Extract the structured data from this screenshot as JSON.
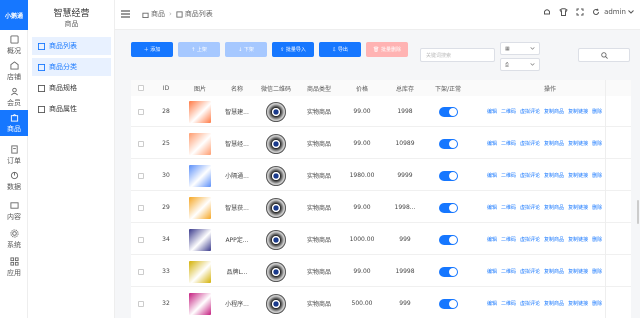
{
  "app": {
    "logo_text": "小鹅通",
    "brand_color": "#1677ff"
  },
  "rail": {
    "items": [
      {
        "label": "概况",
        "icon": "dashboard-icon"
      },
      {
        "label": "店铺",
        "icon": "store-icon"
      },
      {
        "label": "会员",
        "icon": "user-icon"
      },
      {
        "label": "商品",
        "icon": "goods-icon",
        "active": true
      },
      {
        "label": "订单",
        "icon": "order-icon"
      },
      {
        "label": "数据",
        "icon": "data-icon"
      },
      {
        "label": "内容",
        "icon": "content-icon"
      },
      {
        "label": "系统",
        "icon": "gear-icon"
      },
      {
        "label": "应用",
        "icon": "apps-icon"
      }
    ]
  },
  "submenu": {
    "title": "智慧经营",
    "subtitle": "商品",
    "items": [
      {
        "label": "商品列表",
        "active": true
      },
      {
        "label": "商品分类",
        "active": true
      },
      {
        "label": "商品规格",
        "active": false
      },
      {
        "label": "商品属性",
        "active": false
      }
    ]
  },
  "header": {
    "breadcrumb": [
      "商品",
      "商品列表"
    ],
    "user": "admin"
  },
  "toolbar": {
    "add": "添加",
    "list_up": "上架",
    "list_down": "下架",
    "import": "批量导入",
    "export": "导出",
    "batch_delete": "批量删除",
    "keyword_placeholder": "关键词搜索"
  },
  "table": {
    "headers": [
      "ID",
      "图片",
      "名称",
      "微信二维码",
      "商品类型",
      "价格",
      "总库存",
      "下架/正常",
      "操作"
    ],
    "actions": [
      "编辑",
      "二维码",
      "虚拟评论",
      "复制商品",
      "复制链接",
      "删除"
    ],
    "rows": [
      {
        "id": "28",
        "name": "智慧建...",
        "type": "实物商品",
        "price": "99.00",
        "stock": "1998"
      },
      {
        "id": "25",
        "name": "智慧经...",
        "type": "实物商品",
        "price": "99.00",
        "stock": "10989"
      },
      {
        "id": "30",
        "name": "小隔通...",
        "type": "实物商品",
        "price": "1980.00",
        "stock": "9999"
      },
      {
        "id": "29",
        "name": "智慧获...",
        "type": "实物商品",
        "price": "99.00",
        "stock": "1998..."
      },
      {
        "id": "34",
        "name": "APP定...",
        "type": "实物商品",
        "price": "1000.00",
        "stock": "999"
      },
      {
        "id": "33",
        "name": "品牌L...",
        "type": "实物商品",
        "price": "99.00",
        "stock": "19998"
      },
      {
        "id": "32",
        "name": "小程序...",
        "type": "实物商品",
        "price": "500.00",
        "stock": "999"
      }
    ]
  }
}
